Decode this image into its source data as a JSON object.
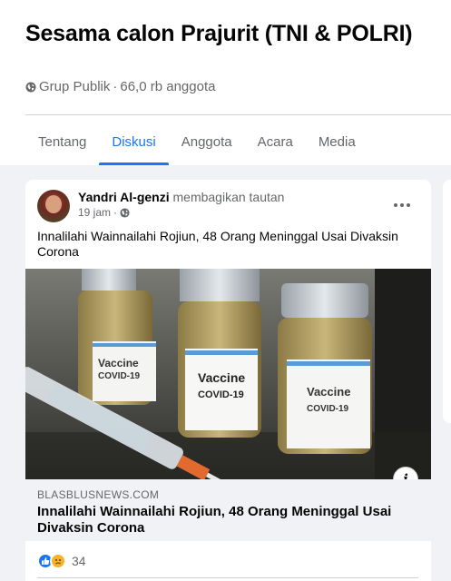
{
  "group": {
    "name": "Sesama calon Prajurit (TNI & POLRI)",
    "privacy": "Grup Publik",
    "separator": "·",
    "members": "66,0 rb anggota"
  },
  "tabs": [
    {
      "label": "Tentang",
      "active": false
    },
    {
      "label": "Diskusi",
      "active": true
    },
    {
      "label": "Anggota",
      "active": false
    },
    {
      "label": "Acara",
      "active": false
    },
    {
      "label": "Media",
      "active": false
    }
  ],
  "post": {
    "author": "Yandri Al-genzi",
    "action": "membagikan tautan",
    "time": "19 jam",
    "time_separator": "·",
    "text": "Innalilahi Wainnailahi Rojiun, 48 Orang Meninggal Usai Divaksin Corona",
    "image_labels": [
      {
        "line1": "Vaccine",
        "line2": "COVID-19"
      },
      {
        "line1": "Vaccine",
        "line2": "COVID-19"
      },
      {
        "line1": "Vaccine",
        "line2": "COVID-19"
      }
    ],
    "info_icon": "i",
    "link": {
      "domain": "BLASBLUSNEWS.COM",
      "title": "Innalilahi Wainnailahi Rojiun, 48 Orang Meninggal Usai Divaksin Corona"
    },
    "reactions": {
      "types": [
        "like",
        "sad"
      ],
      "count": "34"
    }
  },
  "colors": {
    "accent": "#1877f2",
    "secondary_text": "#65676b",
    "background": "#f0f2f5"
  },
  "icons": [
    "globe-icon",
    "more-options-icon",
    "info-icon",
    "like-reaction-icon",
    "sad-reaction-icon"
  ]
}
